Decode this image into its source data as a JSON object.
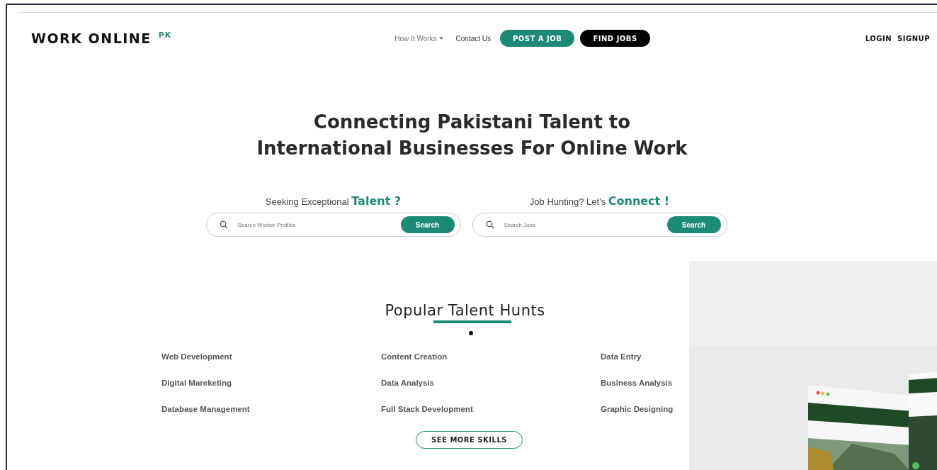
{
  "header": {
    "logo": "WORK ONLINE",
    "logo_badge": "PK",
    "nav": [
      {
        "label": "How It Works",
        "kind": "dropdown"
      },
      {
        "label": "Contact Us",
        "kind": "link"
      },
      {
        "label": "POST A JOB",
        "kind": "primary"
      },
      {
        "label": "FIND JOBS",
        "kind": "dark"
      }
    ],
    "account": [
      "LOGIN",
      "SIGNUP"
    ]
  },
  "hero": {
    "title": [
      "Connecting Pakistani Talent to",
      "International Businesses For Online Work"
    ],
    "searches": [
      {
        "heading": "Seeking Exceptional **Talent ?**",
        "placeholder": "Search Worker Profiles",
        "button": "Search"
      },
      {
        "heading": "Job Hunting? Let's **Connect !**",
        "placeholder": "Search Jobs",
        "button": "Search"
      }
    ]
  },
  "talent": {
    "title": [
      "Popular",
      "Talent",
      "Hunts"
    ],
    "skills": [
      "Web Development",
      "Content Creation",
      "Data Entry",
      "Digital Mareketing",
      "Data Analysis",
      "Business Analysis",
      "Database Management",
      "Full Stack Development",
      "Graphic Designing"
    ],
    "more_button": "SEE MORE SKILLS"
  }
}
